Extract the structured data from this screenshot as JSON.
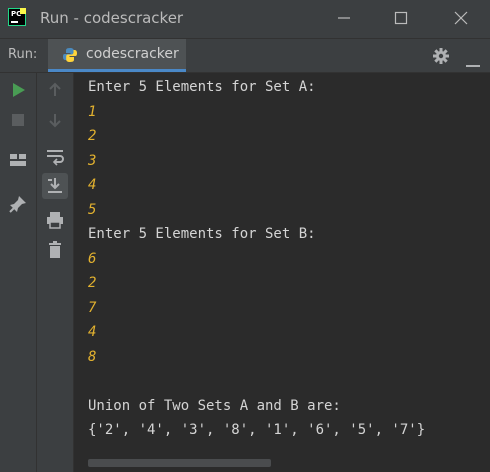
{
  "window": {
    "title": "Run - codescracker"
  },
  "runbar": {
    "label": "Run:",
    "tab_label": "codescracker"
  },
  "colors": {
    "run_green": "#499c54",
    "accent_blue": "#4a88c7",
    "input_yellow": "#e2b12f"
  },
  "console": {
    "lines": [
      {
        "text": "Enter 5 Elements for Set A:",
        "kind": "output"
      },
      {
        "text": "1",
        "kind": "input"
      },
      {
        "text": "2",
        "kind": "input"
      },
      {
        "text": "3",
        "kind": "input"
      },
      {
        "text": "4",
        "kind": "input"
      },
      {
        "text": "5",
        "kind": "input"
      },
      {
        "text": "Enter 5 Elements for Set B:",
        "kind": "output"
      },
      {
        "text": "6",
        "kind": "input"
      },
      {
        "text": "2",
        "kind": "input"
      },
      {
        "text": "7",
        "kind": "input"
      },
      {
        "text": "4",
        "kind": "input"
      },
      {
        "text": "8",
        "kind": "input"
      },
      {
        "text": "",
        "kind": "output"
      },
      {
        "text": "Union of Two Sets A and B are:",
        "kind": "output"
      },
      {
        "text": "{'2', '4', '3', '8', '1', '6', '5', '7'}",
        "kind": "output"
      }
    ]
  }
}
